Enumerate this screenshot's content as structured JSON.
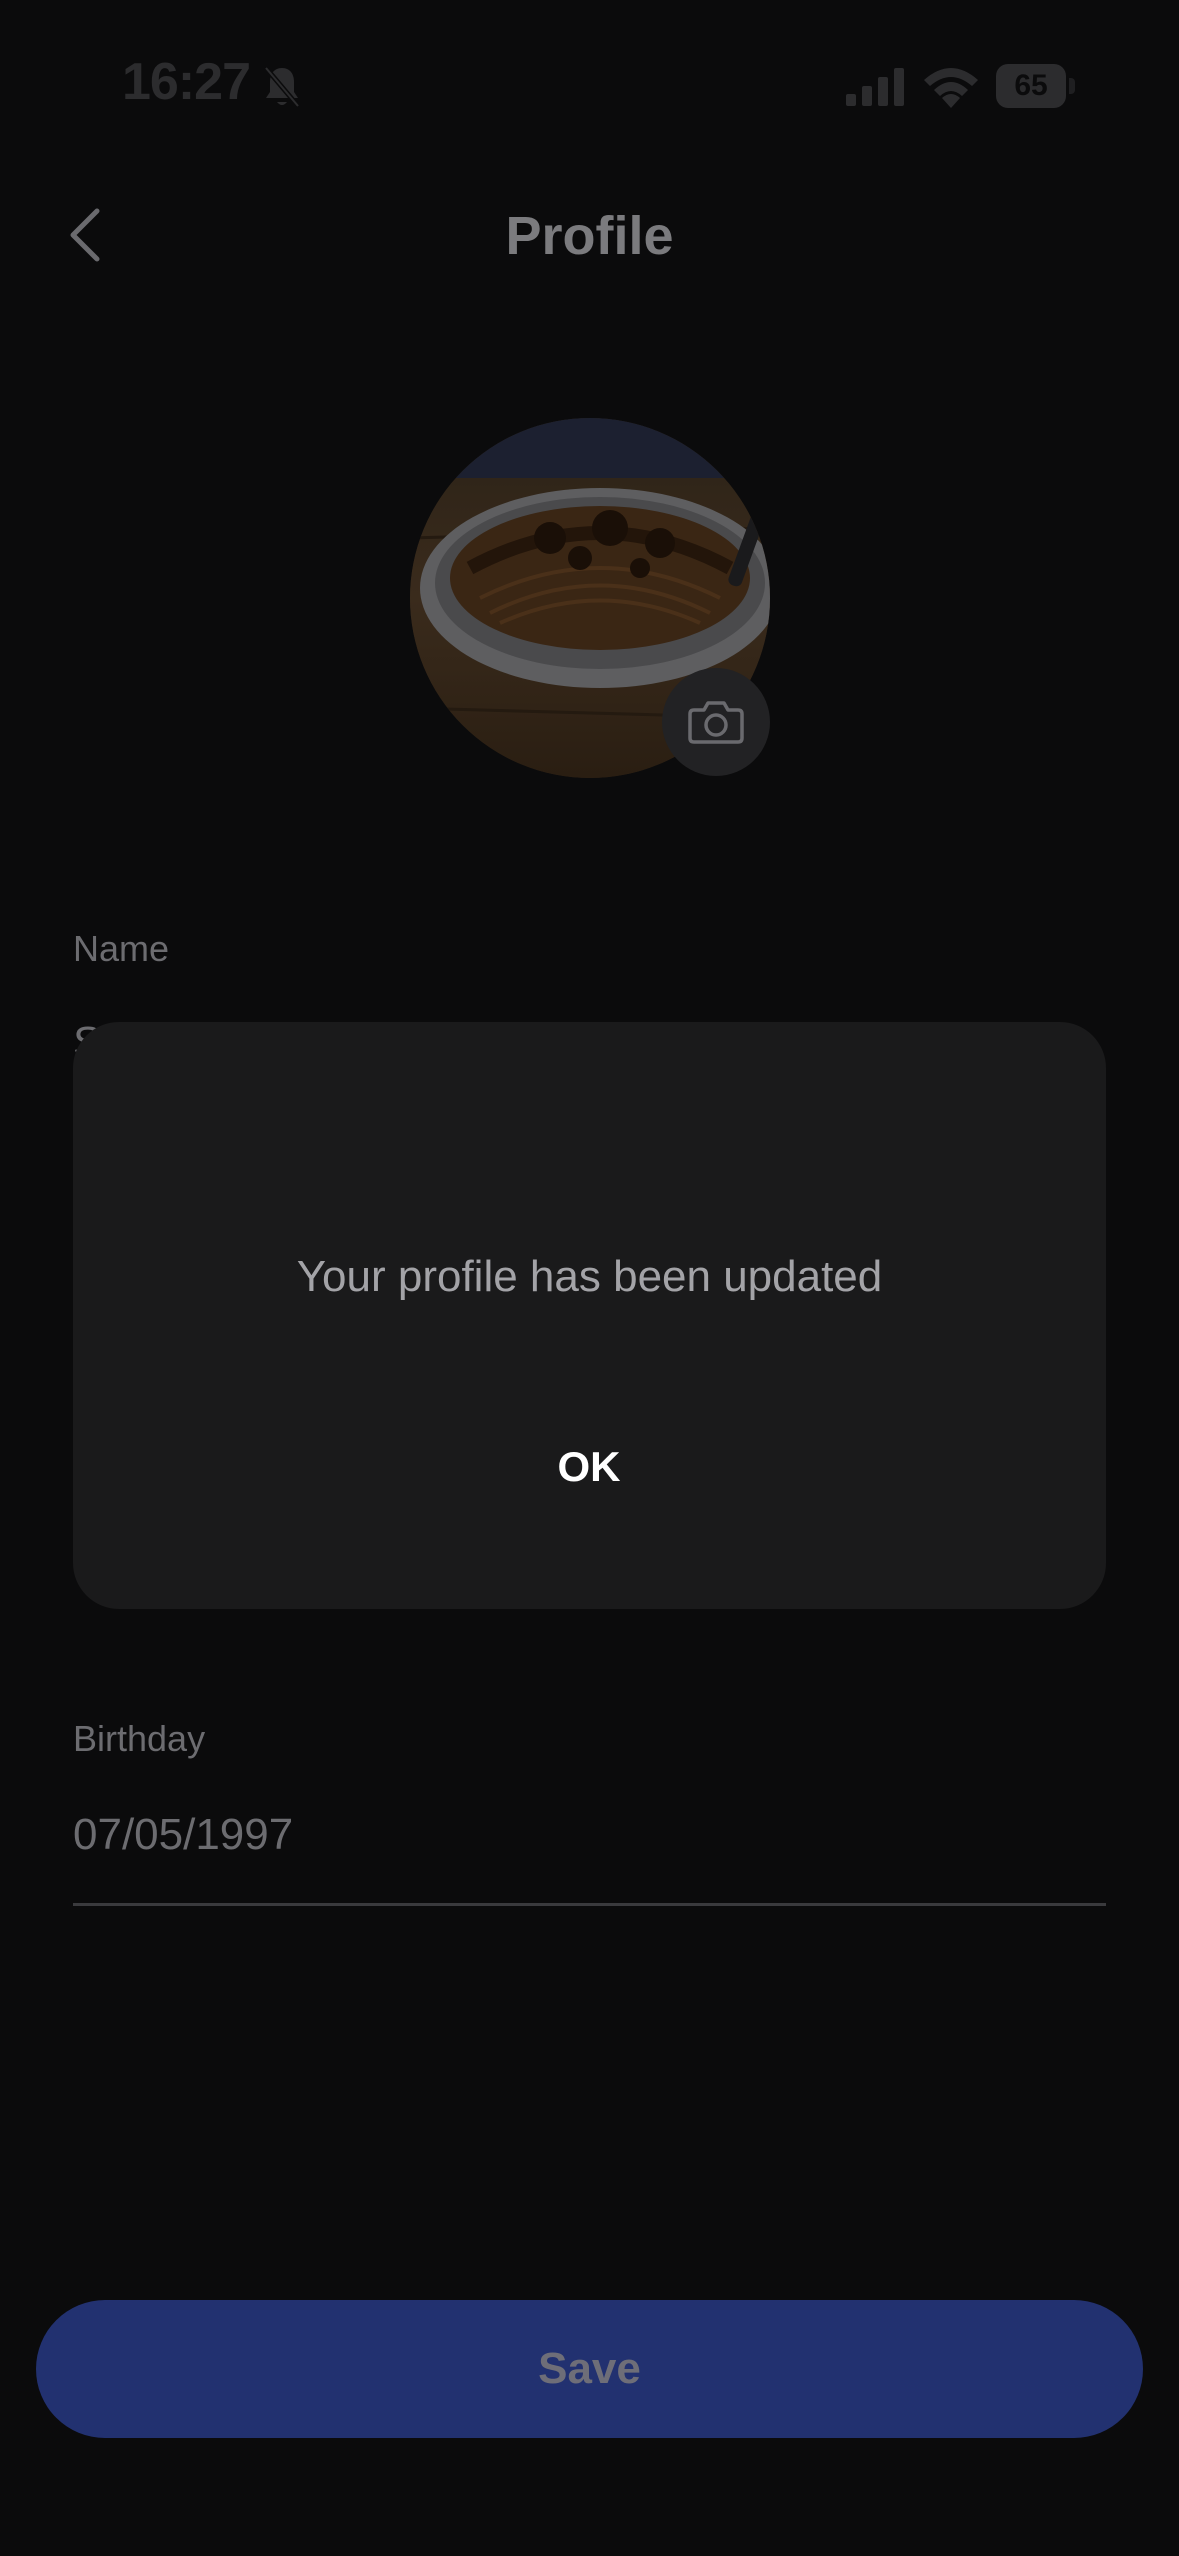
{
  "status_bar": {
    "time": "16:27",
    "battery": "65"
  },
  "header": {
    "title": "Profile"
  },
  "form": {
    "name_label": "Name",
    "name_value_partial": "S",
    "birthday_label": "Birthday",
    "birthday_value": "07/05/1997"
  },
  "dialog": {
    "message": "Your profile has been updated",
    "ok_label": "OK"
  },
  "footer": {
    "save_label": "Save"
  },
  "icons": {
    "back": "chevron-left-icon",
    "camera": "camera-icon",
    "bell_muted": "bell-slash-icon",
    "signal": "cellular-signal-icon",
    "wifi": "wifi-icon",
    "battery": "battery-icon"
  },
  "colors": {
    "background": "#0b0b0c",
    "dialog": "#1a1a1b",
    "save_button": "#223170"
  }
}
